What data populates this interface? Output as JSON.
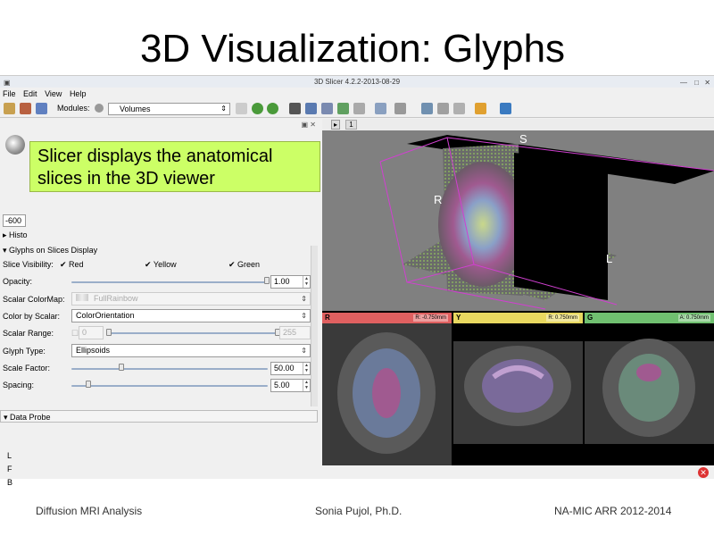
{
  "slide": {
    "title": "3D Visualization: Glyphs",
    "footer_left": "Diffusion MRI Analysis",
    "footer_center": "Sonia Pujol, Ph.D.",
    "footer_right": "NA-MIC ARR 2012-2014"
  },
  "window": {
    "title": "3D Slicer 4.2.2-2013-08-29"
  },
  "menu": [
    "File",
    "Edit",
    "View",
    "Help"
  ],
  "toolbar": {
    "modules_label": "Modules:",
    "module_selected": "Volumes"
  },
  "callout": {
    "line1": "Slicer displays the anatomical",
    "line2": "slices in the 3D viewer"
  },
  "left_panel": {
    "window_level": "-600",
    "histogram_label": "Histo",
    "glyphs_section": "Glyphs on Slices Display",
    "slice_visibility_label": "Slice Visibility:",
    "vis_red": "Red",
    "vis_yellow": "Yellow",
    "vis_green": "Green",
    "opacity_label": "Opacity:",
    "opacity_value": "1.00",
    "opacity_level": 1.0,
    "scalar_colormap_label": "Scalar ColorMap:",
    "scalar_colormap_value": "FullRainbow",
    "color_by_scalar_label": "Color by Scalar:",
    "color_by_scalar_value": "ColorOrientation",
    "scalar_range_label": "Scalar Range:",
    "scalar_range_min": "0",
    "scalar_range_max": "255",
    "glyph_type_label": "Glyph Type:",
    "glyph_type_value": "Ellipsoids",
    "scale_factor_label": "Scale Factor:",
    "scale_factor_value": "50.00",
    "spacing_label": "Spacing:",
    "spacing_value": "5.00",
    "data_probe_label": "Data Probe",
    "probe_l": "L",
    "probe_f": "F",
    "probe_b": "B"
  },
  "view3d": {
    "tab_label": "1",
    "orient_s": "S",
    "orient_r": "R",
    "orient_l": "L"
  },
  "slice_views": {
    "red_label": "R",
    "red_value": "R: -0.750mm",
    "yellow_label": "Y",
    "yellow_value": "R: 0.750mm",
    "green_label": "G",
    "green_value": "A: 0.750mm"
  },
  "colors": {
    "callout_bg": "#ccff66",
    "red_bar": "#e06060",
    "yellow_bar": "#e8d860",
    "green_bar": "#70c070",
    "box_magenta": "#d040d0"
  }
}
